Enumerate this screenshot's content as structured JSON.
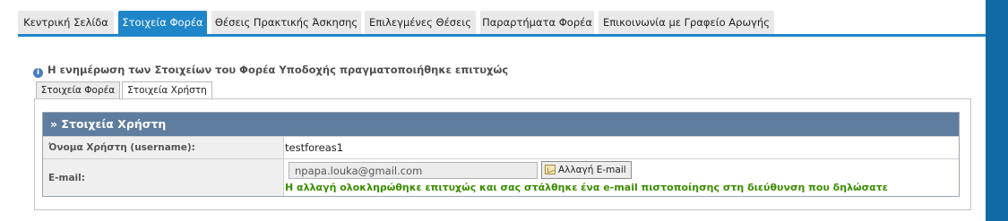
{
  "topnav": {
    "tabs": [
      {
        "label": "Κεντρική Σελίδα",
        "active": false
      },
      {
        "label": "Στοιχεία Φορέα",
        "active": true
      },
      {
        "label": "Θέσεις Πρακτικής Άσκησης",
        "active": false
      },
      {
        "label": "Επιλεγμένες Θέσεις",
        "active": false
      },
      {
        "label": "Παραρτήματα Φορέα",
        "active": false
      },
      {
        "label": "Επικοινωνία με Γραφείο Αρωγής",
        "active": false
      }
    ]
  },
  "notice": {
    "icon": "info-icon",
    "text": "Η ενημέρωση των Στοιχείων του Φορέα Υποδοχής πραγματοποιήθηκε επιτυχώς"
  },
  "subtabs": [
    {
      "label": "Στοιχεία Φορέα",
      "active": false
    },
    {
      "label": "Στοιχεία Χρήστη",
      "active": true
    }
  ],
  "user_panel": {
    "header": "» Στοιχεία Χρήστη",
    "username_label": "Όνομα Χρήστη (username):",
    "username_value": "testforeas1",
    "email_label": "E-mail:",
    "email_value": "npapa.louka@gmail.com",
    "change_email_button": "Αλλαγή E-mail",
    "success_message": "Η αλλαγή ολοκληρώθηκε επιτυχώς και σας στάλθηκε ένα e-mail πιστοποίησης στη διεύθυνση που δηλώσατε"
  },
  "colors": {
    "accent": "#1f86c9",
    "panel_header": "#5f7e9f",
    "success": "#3a8d00",
    "outer_background": "#0f6aa6"
  }
}
